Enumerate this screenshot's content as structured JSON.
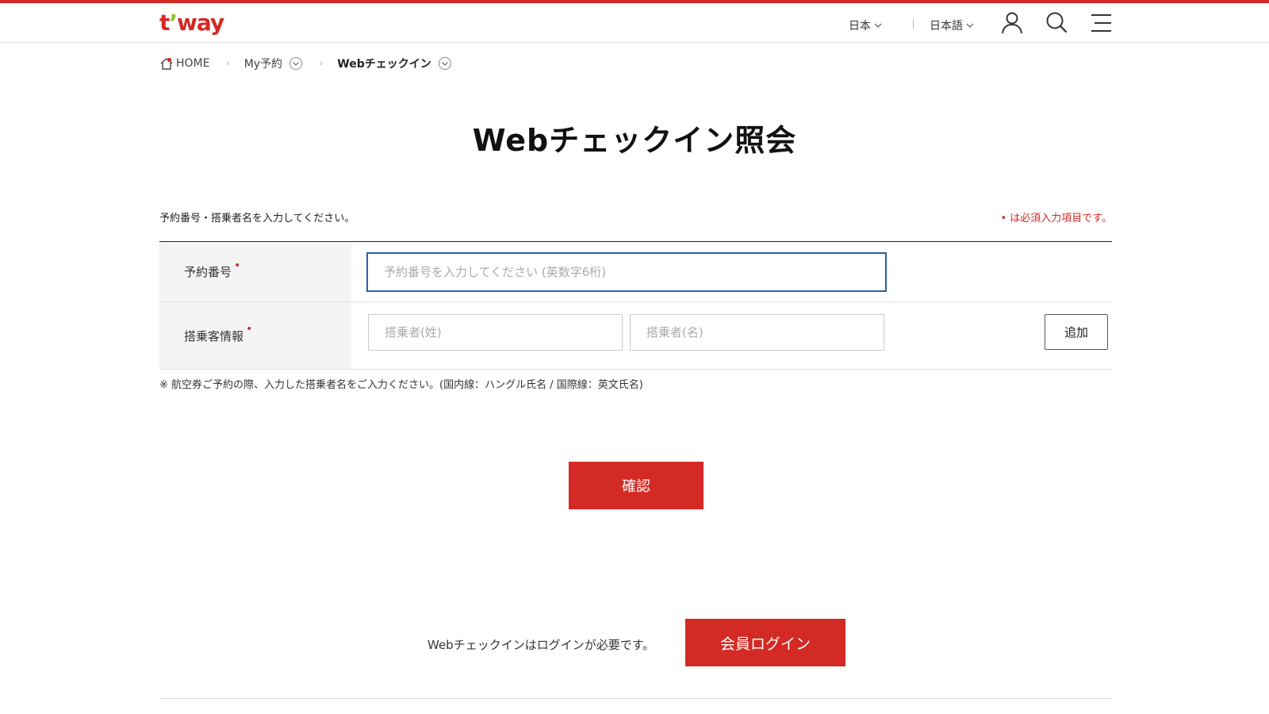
{
  "header": {
    "logo": {
      "t": "t",
      "apostrophe": "’",
      "rest": "way"
    },
    "country_label": "日本",
    "language_label": "日本語",
    "icons": {
      "user": "user-icon",
      "search": "search-icon",
      "menu": "menu-icon"
    }
  },
  "breadcrumb": {
    "home": "HOME",
    "items": [
      "My予約",
      "Webチェックイン"
    ]
  },
  "page": {
    "title": "Webチェックイン照会",
    "guide": "予約番号・搭乗者名を入力してください。",
    "required_note": "• は必須入力項目です。",
    "required_mark": "•"
  },
  "form": {
    "reservation": {
      "label": "予約番号",
      "placeholder": "予約番号を入力してください (英数字6桁)",
      "value": ""
    },
    "passenger": {
      "label": "搭乗客情報",
      "last_placeholder": "搭乗者(姓)",
      "first_placeholder": "搭乗者(名)",
      "add_label": "追加"
    },
    "notice": "※ 航空券ご予約の際、入力した搭乗者名をご入力ください。(国内線：ハングル氏名 / 国際線：英文氏名)"
  },
  "actions": {
    "confirm_label": "確認",
    "login_message": "Webチェックインはログインが必要です。",
    "login_label": "会員ログイン"
  },
  "colors": {
    "brand_red": "#d42a25",
    "focus_blue": "#2b5fad",
    "logo_accent_green": "#8bbf2a"
  }
}
